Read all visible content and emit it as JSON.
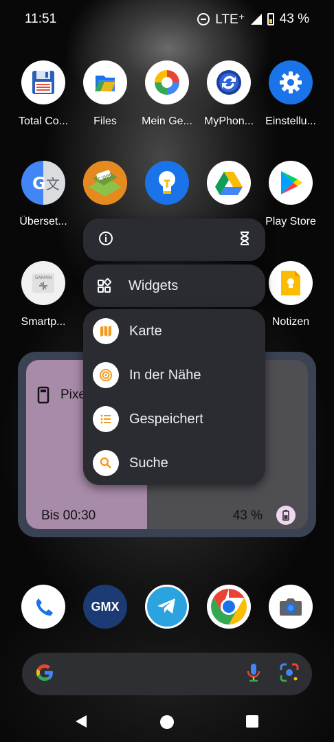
{
  "status_bar": {
    "time": "11:51",
    "network": "LTE⁺",
    "battery": "43 %"
  },
  "apps_row1": [
    {
      "label": "Total Co...",
      "icon": "total-commander-icon"
    },
    {
      "label": "Files",
      "icon": "files-icon"
    },
    {
      "label": "Mein Ge...",
      "icon": "mein-geraet-icon"
    },
    {
      "label": "MyPhon...",
      "icon": "myphone-icon"
    },
    {
      "label": "Einstellu...",
      "icon": "settings-gear-icon"
    }
  ],
  "apps_row2": [
    {
      "label": "Überset...",
      "icon": "translate-icon"
    },
    {
      "label": "",
      "icon": "cgeo-icon"
    },
    {
      "label": "",
      "icon": "lightbulb-icon"
    },
    {
      "label": "",
      "icon": "drive-icon"
    },
    {
      "label": "Play Store",
      "icon": "play-store-icon"
    }
  ],
  "apps_row3": [
    {
      "label": "Smartp...",
      "icon": "garmin-icon"
    },
    {
      "label": "Notizen",
      "icon": "notes-icon"
    }
  ],
  "context_menu": {
    "info_icon": "info-icon",
    "pause_icon": "hourglass-icon",
    "widgets_label": "Widgets",
    "shortcuts": [
      {
        "label": "Karte",
        "icon": "map-icon"
      },
      {
        "label": "In der Nähe",
        "icon": "nearby-icon"
      },
      {
        "label": "Gespeichert",
        "icon": "list-icon"
      },
      {
        "label": "Suche",
        "icon": "search-icon"
      }
    ]
  },
  "widget": {
    "title": "Pixe",
    "timer": "Bis 00:30",
    "battery": "43 %"
  },
  "dock": [
    {
      "icon": "phone-icon"
    },
    {
      "icon": "gmx-icon",
      "text": "GMX"
    },
    {
      "icon": "telegram-icon"
    },
    {
      "icon": "chrome-icon"
    },
    {
      "icon": "camera-icon"
    }
  ],
  "colors": {
    "menu_bg": "#2a2c31",
    "accent_orange": "#f29b23",
    "widget_frame": "#3a4253",
    "widget_left": "#a88aa9",
    "widget_right": "#4f4f53"
  }
}
